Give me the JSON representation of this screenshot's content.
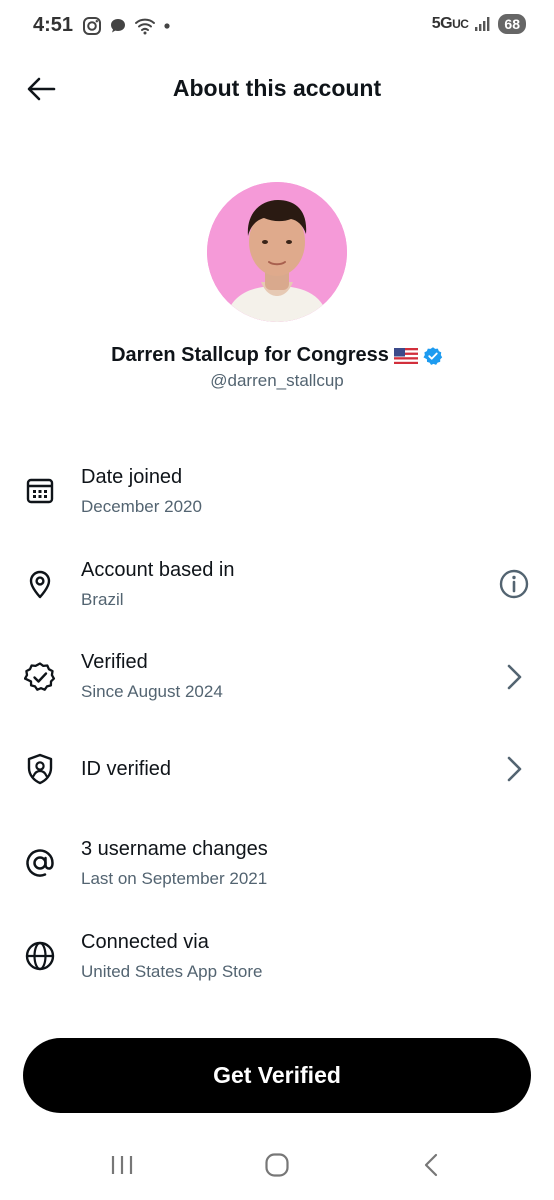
{
  "status_bar": {
    "time": "4:51",
    "network": "5G",
    "network_suffix": "UC",
    "battery": "68"
  },
  "header": {
    "title": "About this account",
    "back_icon": "arrow-left-icon"
  },
  "profile": {
    "name": "Darren Stallcup for Congress",
    "handle": "@darren_stallcup",
    "flag": "us-flag-icon",
    "badge": "verified-badge-icon",
    "avatar_bg": "#f59ad8",
    "badge_color": "#1d9bf0"
  },
  "rows": [
    {
      "icon": "calendar-icon",
      "title": "Date joined",
      "subtitle": "December 2020",
      "action": null
    },
    {
      "icon": "location-pin-icon",
      "title": "Account based in",
      "subtitle": "Brazil",
      "action": "info-icon"
    },
    {
      "icon": "verified-seal-icon",
      "title": "Verified",
      "subtitle": "Since August 2024",
      "action": "chevron-right-icon"
    },
    {
      "icon": "id-shield-icon",
      "title": "ID verified",
      "subtitle": "",
      "action": "chevron-right-icon"
    },
    {
      "icon": "at-sign-icon",
      "title": "3 username changes",
      "subtitle": "Last on September 2021",
      "action": null
    },
    {
      "icon": "globe-icon",
      "title": "Connected via",
      "subtitle": "United States App Store",
      "action": null
    }
  ],
  "cta": {
    "label": "Get Verified"
  },
  "colors": {
    "text_primary": "#0f1419",
    "text_secondary": "#536471",
    "button_bg": "#000000"
  }
}
